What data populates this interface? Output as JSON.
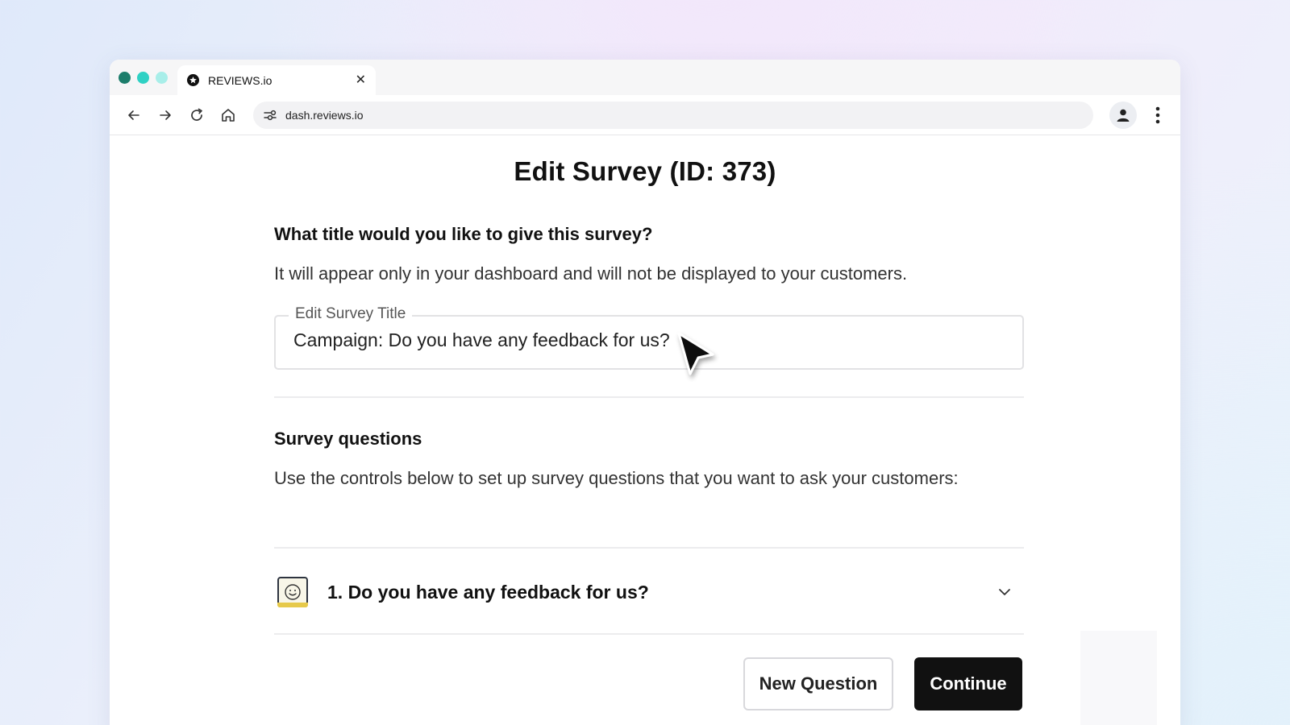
{
  "browser": {
    "tab_title": "REVIEWS.io",
    "tab_close_label": "✕",
    "url": "dash.reviews.io",
    "traffic_colors": [
      "#1c7d6b",
      "#2fd1c4",
      "#a8eee9"
    ]
  },
  "page": {
    "title": "Edit Survey (ID: 373)"
  },
  "title_section": {
    "heading": "What title would you like to give this survey?",
    "description": "It will appear only in your dashboard and will not be displayed to your customers.",
    "field_label": "Edit Survey Title",
    "field_value": "Campaign: Do you have any feedback for us?"
  },
  "questions_section": {
    "heading": "Survey questions",
    "description": "Use the controls below to set up survey questions that you want to ask your customers:",
    "questions": [
      {
        "label": "1. Do you have any feedback for us?",
        "icon": "smiley-face-icon"
      }
    ]
  },
  "actions": {
    "new_question_label": "New Question",
    "continue_label": "Continue"
  }
}
